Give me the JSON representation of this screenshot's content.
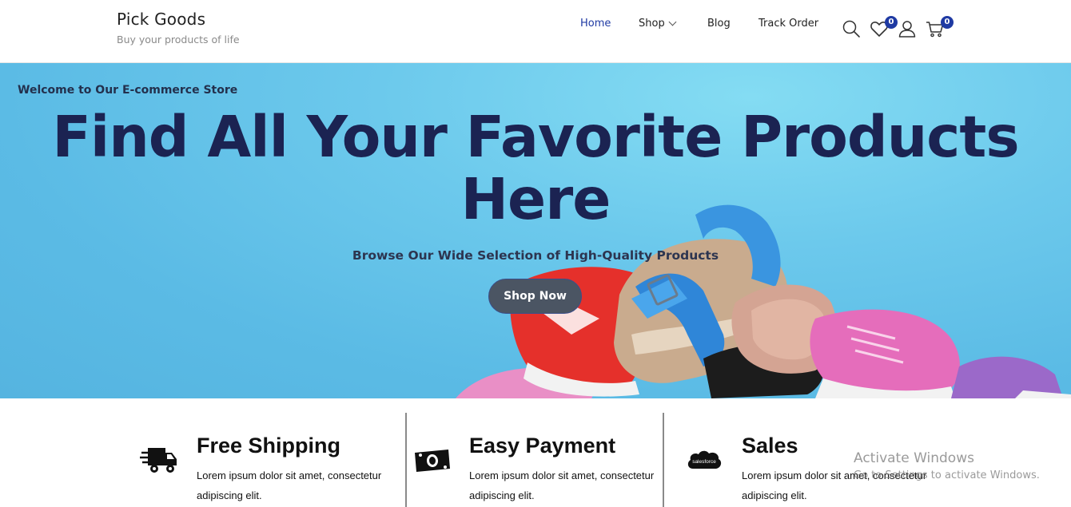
{
  "brand": {
    "title": "Pick Goods",
    "tagline": "Buy your products of life"
  },
  "nav": {
    "items": [
      {
        "label": "Home",
        "active": true
      },
      {
        "label": "Shop",
        "has_dropdown": true
      },
      {
        "label": "Blog"
      },
      {
        "label": "Track Order"
      }
    ],
    "wishlist_count": "0",
    "cart_count": "0",
    "icons": [
      "search-icon",
      "heart-icon",
      "user-icon",
      "cart-icon"
    ]
  },
  "hero": {
    "welcome": "Welcome to Our E-commerce Store",
    "title": "Find All Your Favorite Products Here",
    "subtitle": "Browse Our Wide Selection of High-Quality Products",
    "button": "Shop Now"
  },
  "features": [
    {
      "icon": "truck-icon",
      "title": "Free Shipping",
      "text": "Lorem ipsum dolor sit amet, consectetur adipiscing elit."
    },
    {
      "icon": "banknote-icon",
      "title": "Easy Payment",
      "text": "Lorem ipsum dolor sit amet, consectetur adipiscing elit."
    },
    {
      "icon": "salesforce-icon",
      "title": "Sales",
      "text": "Lorem ipsum dolor sit amet, consectetur adipiscing elit."
    }
  ],
  "salesforce_logo_text": "salesforce",
  "watermark": {
    "line1": "Activate Windows",
    "line2": "Go to Settings to activate Windows."
  },
  "colors": {
    "accent": "#1f3aa3",
    "hero_bg": "#5bbbe5",
    "hero_title": "#1b2352",
    "button_bg": "#4b5563"
  }
}
